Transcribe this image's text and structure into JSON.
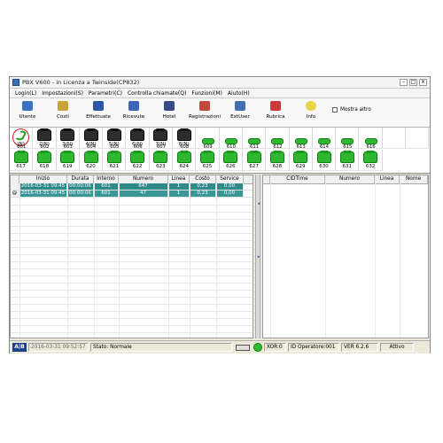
{
  "window": {
    "title": "PBX V600 - in Licenza a Twinside(CP832)"
  },
  "menu": [
    "Login(L)",
    "Impostazioni(S)",
    "Parametri(C)",
    "Controlla chiamate(Q)",
    "Funzioni(M)",
    "Aiuto(H)"
  ],
  "toolbar": {
    "buttons": [
      {
        "label": "Utente",
        "color": "#3a72c4"
      },
      {
        "label": "Costi",
        "color": "#c9a23a"
      },
      {
        "label": "Effettuate",
        "color": "#2d56a8"
      },
      {
        "label": "Ricevute",
        "color": "#3b66b8"
      },
      {
        "label": "Hotel",
        "color": "#394a8a"
      },
      {
        "label": "Registrazioni",
        "color": "#c04a3a"
      },
      {
        "label": "ExtUser",
        "color": "#3f6fb0"
      },
      {
        "label": "Rubrica",
        "color": "#c93b3b"
      },
      {
        "label": "Info",
        "color": "#e8d545"
      }
    ],
    "mostra_altro": "Mostra altro"
  },
  "extensions": {
    "row1": [
      {
        "num": "(N)",
        "state": "sel"
      },
      {
        "num": "2(N)",
        "state": "k"
      },
      {
        "num": "3(N)",
        "state": "k"
      },
      {
        "num": "4(N)",
        "state": "k"
      },
      {
        "num": "5(N)",
        "state": "k"
      },
      {
        "num": "6(N)",
        "state": "k"
      },
      {
        "num": "7(N)",
        "state": "k"
      },
      {
        "num": "8(N)",
        "state": "k"
      },
      {
        "num": "",
        "state": "e"
      },
      {
        "num": "",
        "state": "e"
      },
      {
        "num": "",
        "state": "e"
      },
      {
        "num": "",
        "state": "e"
      },
      {
        "num": "",
        "state": "e"
      },
      {
        "num": "",
        "state": "e"
      },
      {
        "num": "",
        "state": "e"
      },
      {
        "num": "",
        "state": "e"
      },
      {
        "num": "",
        "state": "e"
      },
      {
        "num": "",
        "state": "e"
      }
    ],
    "row1b": [
      {
        "num": "601",
        "state": "sel"
      },
      {
        "num": "602",
        "state": "g"
      },
      {
        "num": "603",
        "state": "g"
      },
      {
        "num": "604",
        "state": "g"
      },
      {
        "num": "605",
        "state": "g"
      },
      {
        "num": "606",
        "state": "g"
      },
      {
        "num": "607",
        "state": "g"
      },
      {
        "num": "608",
        "state": "g"
      },
      {
        "num": "609",
        "state": "g"
      },
      {
        "num": "610",
        "state": "g"
      },
      {
        "num": "611",
        "state": "g"
      },
      {
        "num": "612",
        "state": "g"
      },
      {
        "num": "613",
        "state": "g"
      },
      {
        "num": "614",
        "state": "g"
      },
      {
        "num": "615",
        "state": "g"
      },
      {
        "num": "616",
        "state": "g"
      }
    ],
    "row2": [
      {
        "num": "617"
      },
      {
        "num": "618"
      },
      {
        "num": "619"
      },
      {
        "num": "620"
      },
      {
        "num": "621"
      },
      {
        "num": "622"
      },
      {
        "num": "623"
      },
      {
        "num": "624"
      },
      {
        "num": "625"
      },
      {
        "num": "626"
      },
      {
        "num": "627"
      },
      {
        "num": "628"
      },
      {
        "num": "629"
      },
      {
        "num": "630"
      },
      {
        "num": "631"
      },
      {
        "num": "632"
      }
    ]
  },
  "call_table": {
    "columns": [
      "Inizio",
      "Durata",
      "Interno",
      "Numero",
      "Linea",
      "Costo",
      "Service"
    ],
    "rows": [
      {
        "marker": "",
        "inizio": "2016-03-31 09:45",
        "durata": "00:00:06",
        "interno": "601",
        "numero": "647",
        "linea": "1",
        "costo": "0,23",
        "service": "0,00"
      },
      {
        "marker": "@",
        "inizio": "2016-03-31 09:45",
        "durata": "00:00:06",
        "interno": "601",
        "numero": "47",
        "linea": "1",
        "costo": "0,23",
        "service": "0,00"
      }
    ]
  },
  "cid_table": {
    "columns": [
      "CIDTime",
      "Numero",
      "Linea",
      "Nome"
    ]
  },
  "status": {
    "logo": "A|B",
    "datetime": "2016-03-31 09:52:57",
    "stato": "Stato: Normale",
    "xor": "XOR:0",
    "operatore": "ID Operatore:001",
    "version": "VER 6.2.6",
    "attivo": "Attivo"
  }
}
